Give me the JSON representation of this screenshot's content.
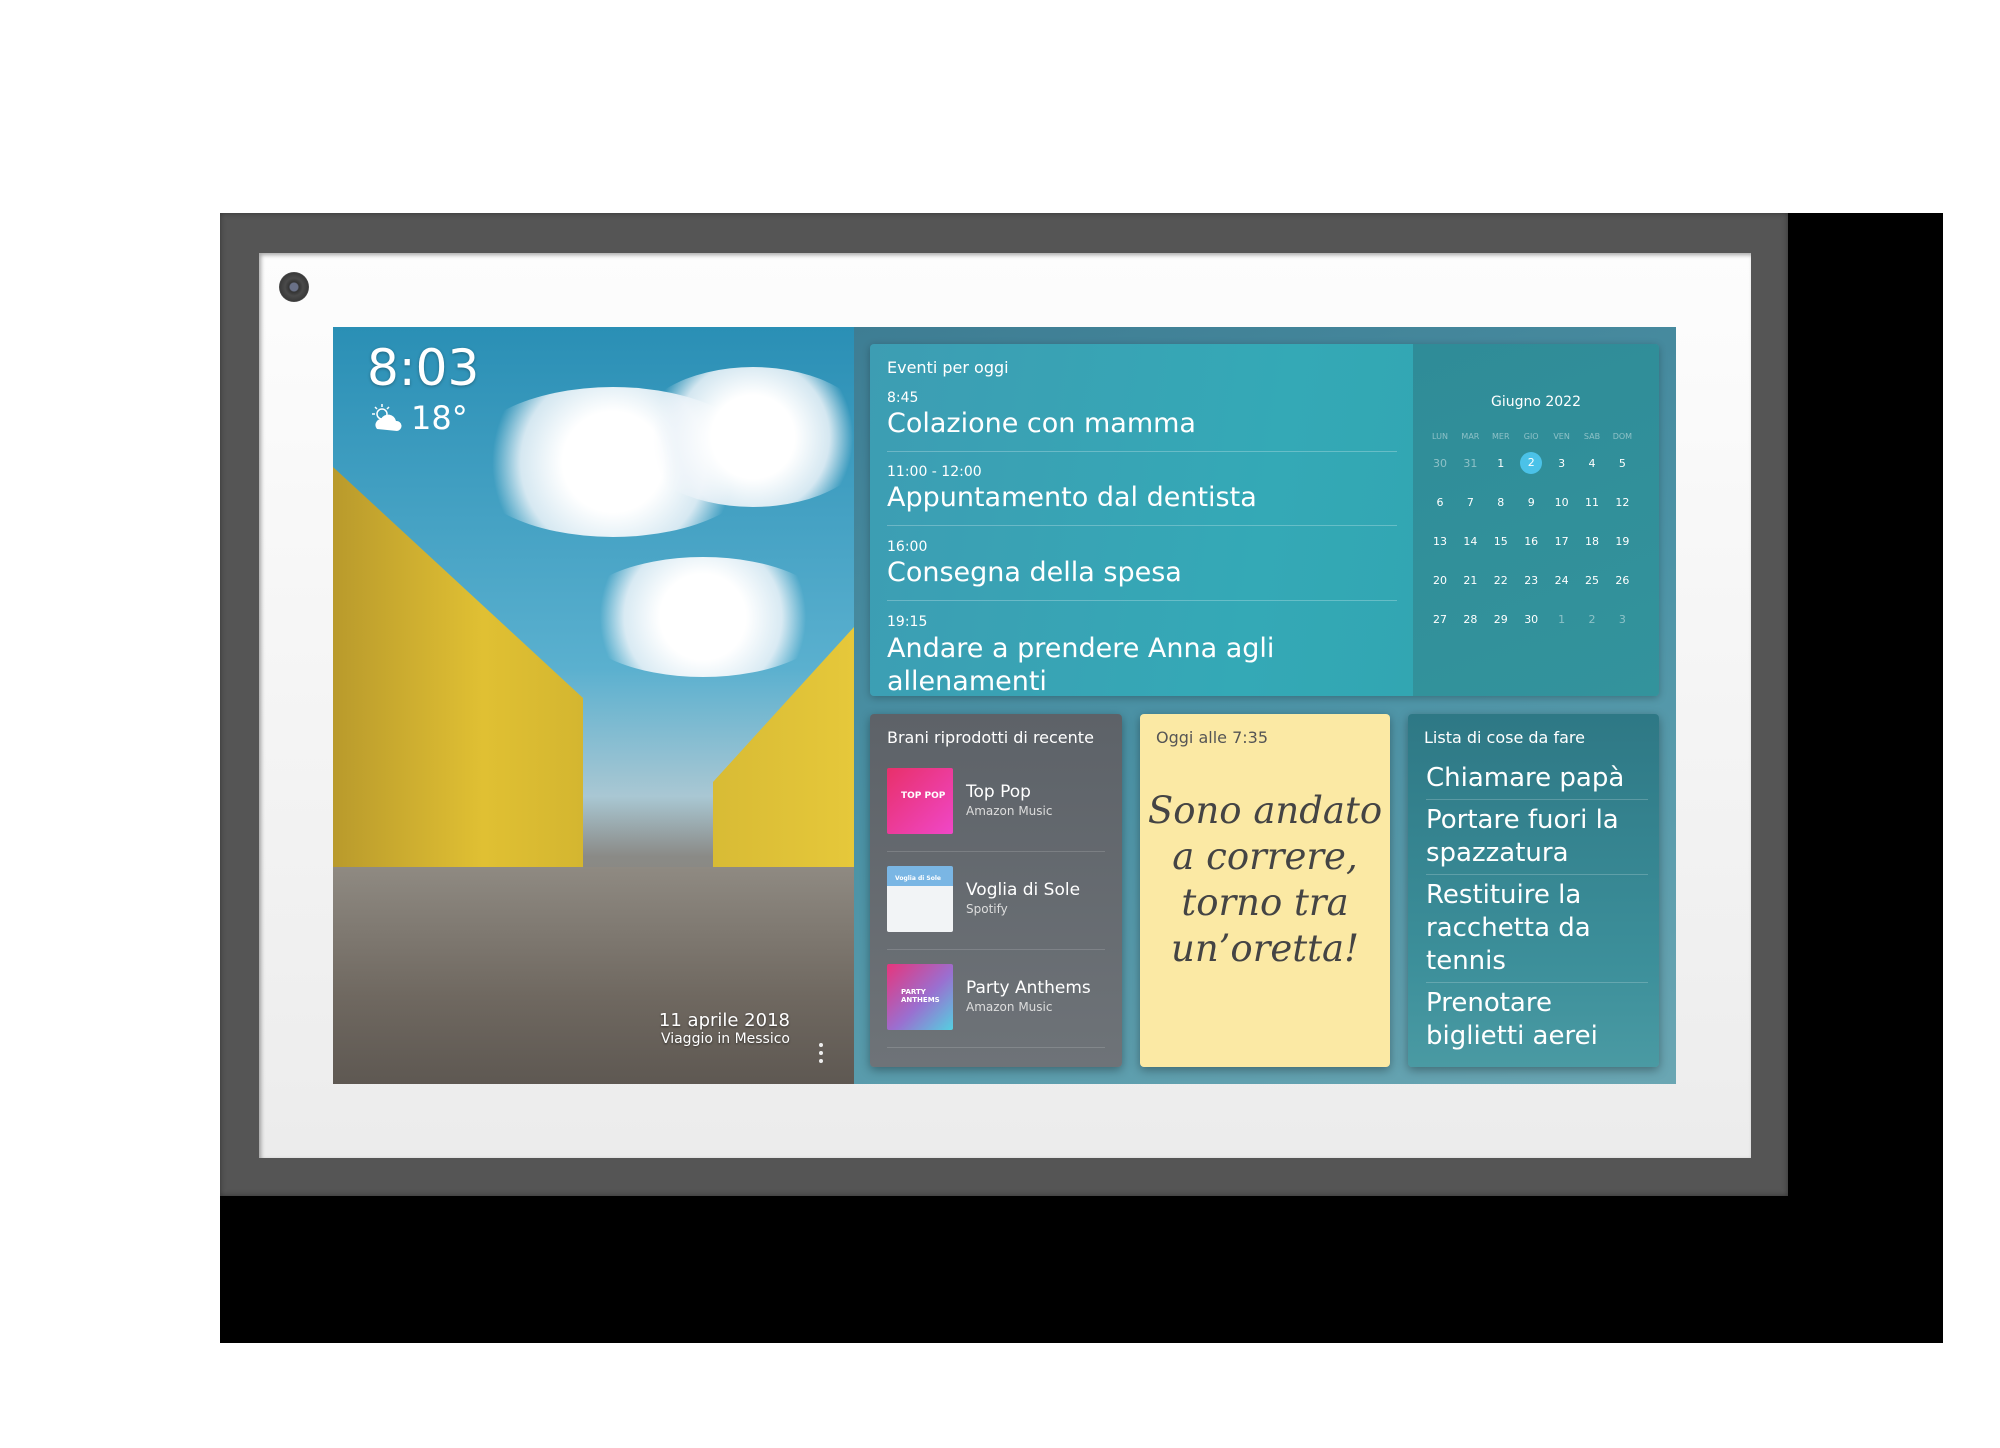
{
  "photo": {
    "date": "11 aprile 2018",
    "caption": "Viaggio in Messico"
  },
  "status": {
    "time": "8:03",
    "temperature": "18°",
    "weather_icon": "partly-sunny-icon"
  },
  "events": {
    "title": "Eventi per oggi",
    "items": [
      {
        "time": "8:45",
        "name": "Colazione con mamma"
      },
      {
        "time": "11:00 - 12:00",
        "name": "Appuntamento dal dentista"
      },
      {
        "time": "16:00",
        "name": "Consegna della spesa"
      },
      {
        "time": "19:15",
        "name": "Andare a prendere Anna agli allenamenti"
      }
    ]
  },
  "calendar": {
    "month": "Giugno 2022",
    "weekdays": [
      "LUN",
      "MAR",
      "MER",
      "GIO",
      "VEN",
      "SAB",
      "DOM"
    ],
    "weeks": [
      [
        "30",
        "31",
        "1",
        "2",
        "3",
        "4",
        "5"
      ],
      [
        "6",
        "7",
        "8",
        "9",
        "10",
        "11",
        "12"
      ],
      [
        "13",
        "14",
        "15",
        "16",
        "17",
        "18",
        "19"
      ],
      [
        "20",
        "21",
        "22",
        "23",
        "24",
        "25",
        "26"
      ],
      [
        "27",
        "28",
        "29",
        "30",
        "1",
        "2",
        "3"
      ]
    ],
    "today": "2",
    "accent": "#4bc2e8"
  },
  "music": {
    "title": "Brani riprodotti di recente",
    "tracks": [
      {
        "name": "Top Pop",
        "source": "Amazon Music",
        "art_text": "TOP POP"
      },
      {
        "name": "Voglia di Sole",
        "source": "Spotify",
        "art_text": "Voglia di Sole"
      },
      {
        "name": "Party Anthems",
        "source": "Amazon Music",
        "art_text": "PARTY ANTHEMS"
      }
    ]
  },
  "note": {
    "time": "Oggi alle 7:35",
    "text": "Sono andato a correre, torno tra un’oretta!",
    "color": "#fbe9a4"
  },
  "todo": {
    "title": "Lista di cose da fare",
    "items": [
      "Chiamare papà",
      "Portare fuori la spazzatura",
      "Restituire la racchetta da tennis",
      "Prenotare biglietti aerei"
    ]
  }
}
